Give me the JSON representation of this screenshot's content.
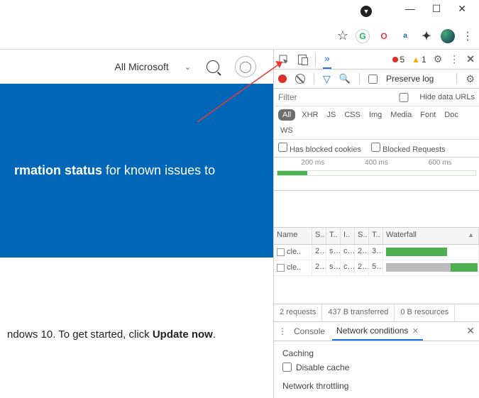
{
  "window": {
    "minimize": "—",
    "maximize": "☐",
    "close": "✕"
  },
  "toolbar": {
    "star": "☆",
    "g": "G",
    "o": "O",
    "a": "a",
    "puzzle": "✦",
    "dots": "⋮"
  },
  "page": {
    "allMicrosoft": "All Microsoft",
    "chev": "⌄",
    "blueText1": "rmation status",
    "blueText2": " for known issues to",
    "bottomText1": "ndows 10. To get started, click ",
    "bottomUpdate": "Update now",
    "bottomDot": "."
  },
  "devtools": {
    "chevrons": "»",
    "errCount": "5",
    "warnCount": "1",
    "gear": "⚙",
    "vdots": "⋮",
    "close": "✕",
    "preserveLog": "Preserve log",
    "filterPlaceholder": "Filter",
    "hideDataUrls": "Hide data URLs",
    "types": [
      "All",
      "XHR",
      "JS",
      "CSS",
      "Img",
      "Media",
      "Font",
      "Doc",
      "WS"
    ],
    "hasBlocked": "Has blocked cookies",
    "blockedReq": "Blocked Requests",
    "ticks": [
      "200 ms",
      "400 ms",
      "600 ms"
    ],
    "cols": {
      "name": "Name",
      "s": "S..",
      "t": "T..",
      "i": "I..",
      "s2": "S..",
      "t2": "T..",
      "wf": "Waterfall"
    },
    "rows": [
      {
        "name": "cle..",
        "s": "2..",
        "t": "s..",
        "i": "c..",
        "s2": "2..",
        "t2": "3..",
        "bar": {
          "type": "green",
          "left": 0,
          "width": 68
        }
      },
      {
        "name": "cle..",
        "s": "2..",
        "t": "s..",
        "i": "c..",
        "s2": "2..",
        "t2": "5..",
        "bar": {
          "type": "mixed",
          "left": 0,
          "greyW": 72,
          "greenL": 72,
          "greenW": 30
        }
      }
    ],
    "status": {
      "req": "2 requests",
      "xfer": "437 B transferred",
      "res": "0 B resources"
    },
    "drawer": {
      "console": "Console",
      "netcond": "Network conditions",
      "x": "✕",
      "close": "✕"
    },
    "caching": "Caching",
    "disableCache": "Disable cache",
    "throttling": "Network throttling"
  }
}
